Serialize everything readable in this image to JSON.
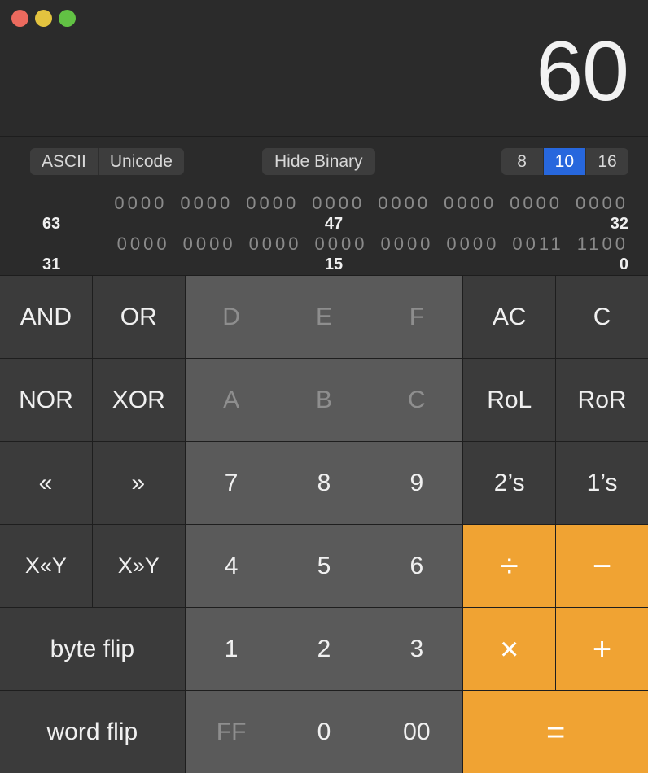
{
  "window": {
    "traffic_lights": [
      {
        "name": "close",
        "color": "#ec6a5e"
      },
      {
        "name": "minimize",
        "color": "#e3c33f"
      },
      {
        "name": "zoom",
        "color": "#62c244"
      }
    ]
  },
  "display": {
    "value": "60"
  },
  "toolbar": {
    "encoding": {
      "options": [
        "ASCII",
        "Unicode"
      ],
      "selected": ""
    },
    "binary_toggle_label": "Hide Binary",
    "base": {
      "options": [
        "8",
        "10",
        "16"
      ],
      "selected": "10"
    }
  },
  "binary": {
    "rows": [
      {
        "nibbles": [
          "0000",
          "0000",
          "0000",
          "0000",
          "0000",
          "0000",
          "0000",
          "0000"
        ],
        "label_high": "63",
        "label_mid": "47",
        "label_low": "32"
      },
      {
        "nibbles": [
          "0000",
          "0000",
          "0000",
          "0000",
          "0000",
          "0000",
          "0011",
          "1100"
        ],
        "label_high": "31",
        "label_mid": "15",
        "label_low": "0"
      }
    ]
  },
  "keypad": {
    "keys": [
      {
        "label": "AND",
        "style": "fn",
        "name": "key-and"
      },
      {
        "label": "OR",
        "style": "fn",
        "name": "key-or"
      },
      {
        "label": "D",
        "style": "num-dim",
        "name": "key-hex-d"
      },
      {
        "label": "E",
        "style": "num-dim",
        "name": "key-hex-e"
      },
      {
        "label": "F",
        "style": "num-dim",
        "name": "key-hex-f"
      },
      {
        "label": "AC",
        "style": "fn",
        "name": "key-all-clear"
      },
      {
        "label": "C",
        "style": "fn",
        "name": "key-clear"
      },
      {
        "label": "NOR",
        "style": "fn",
        "name": "key-nor"
      },
      {
        "label": "XOR",
        "style": "fn",
        "name": "key-xor"
      },
      {
        "label": "A",
        "style": "num-dim",
        "name": "key-hex-a"
      },
      {
        "label": "B",
        "style": "num-dim",
        "name": "key-hex-b"
      },
      {
        "label": "C",
        "style": "num-dim",
        "name": "key-hex-c"
      },
      {
        "label": "RoL",
        "style": "fn",
        "name": "key-rotate-left"
      },
      {
        "label": "RoR",
        "style": "fn",
        "name": "key-rotate-right"
      },
      {
        "label": "«",
        "style": "fn-shift",
        "name": "key-shift-left"
      },
      {
        "label": "»",
        "style": "fn-shift",
        "name": "key-shift-right"
      },
      {
        "label": "7",
        "style": "num",
        "name": "key-7"
      },
      {
        "label": "8",
        "style": "num",
        "name": "key-8"
      },
      {
        "label": "9",
        "style": "num",
        "name": "key-9"
      },
      {
        "label": "2’s",
        "style": "fn",
        "name": "key-twos-complement"
      },
      {
        "label": "1’s",
        "style": "fn",
        "name": "key-ones-complement"
      },
      {
        "label": "X«Y",
        "style": "fn-small",
        "name": "key-x-shift-left-y"
      },
      {
        "label": "X»Y",
        "style": "fn-small",
        "name": "key-x-shift-right-y"
      },
      {
        "label": "4",
        "style": "num",
        "name": "key-4"
      },
      {
        "label": "5",
        "style": "num",
        "name": "key-5"
      },
      {
        "label": "6",
        "style": "num",
        "name": "key-6"
      },
      {
        "label": "÷",
        "style": "op",
        "name": "key-divide"
      },
      {
        "label": "−",
        "style": "op",
        "name": "key-minus"
      },
      {
        "label": "byte flip",
        "style": "fn-wide",
        "name": "key-byte-flip"
      },
      {
        "label": "1",
        "style": "num",
        "name": "key-1"
      },
      {
        "label": "2",
        "style": "num",
        "name": "key-2"
      },
      {
        "label": "3",
        "style": "num",
        "name": "key-3"
      },
      {
        "label": "×",
        "style": "op",
        "name": "key-multiply"
      },
      {
        "label": "+",
        "style": "op",
        "name": "key-plus"
      },
      {
        "label": "word flip",
        "style": "fn-wide",
        "name": "key-word-flip"
      },
      {
        "label": "FF",
        "style": "num-dim",
        "name": "key-ff"
      },
      {
        "label": "0",
        "style": "num",
        "name": "key-0"
      },
      {
        "label": "00",
        "style": "num",
        "name": "key-00"
      },
      {
        "label": "=",
        "style": "op-wide",
        "name": "key-equals"
      }
    ]
  },
  "colors": {
    "accent_blue": "#2767dd",
    "accent_orange": "#f0a333",
    "window_bg": "#2b2b2b",
    "key_fn_bg": "#3b3b3b",
    "key_num_bg": "#5a5a5a"
  }
}
